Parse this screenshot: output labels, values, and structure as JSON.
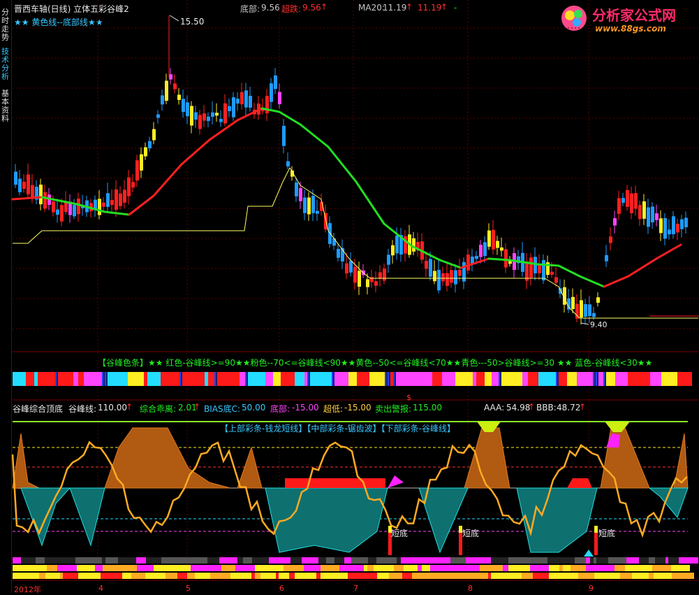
{
  "sidebar": {
    "tabs": [
      {
        "label": "分时走势",
        "color": "#c8c8c8"
      },
      {
        "label": "技术分析",
        "color": "#36c8ff"
      },
      {
        "label": "基本资料",
        "color": "#c8c8c8"
      }
    ]
  },
  "header": {
    "title": "晋西车轴(日线) 立体五彩谷峰2",
    "bottom_label": "底部:",
    "bottom_value": "9.56",
    "chaodie_label": "超跌:",
    "chaodie_value": "9.56",
    "ma20_label": "MA20:",
    "ma20_value": "11.19",
    "ma20_value2": "11.19",
    "ma20_dash": "-",
    "legend_line": "★★ 黄色线--底部线★★"
  },
  "logo": {
    "brand": "分析家公式网",
    "url": "www.88gs.com"
  },
  "annotations": {
    "high_price": "15.50",
    "low_price": "9.40",
    "s_marker": "$",
    "short_bottom": "短底"
  },
  "color_strip": {
    "legend": "【谷峰色条】★★ 红色-谷峰线>=90★★粉色--70<=谷峰线<90★★黄色--50<=谷峰线<70★★青色---50>谷峰线>=30 ★★ 蓝色-谷峰线<30★★"
  },
  "indicator": {
    "name": "谷峰综合顶底",
    "gufeng_label": "谷峰线:",
    "gufeng_value": "110.00",
    "zonghe_label": "综合乖离:",
    "zonghe_value": "2.01",
    "bias_label": "BIAS底C:",
    "bias_value": "50.00",
    "bottom_label": "底部:",
    "bottom_value": "-15.00",
    "chaodi_label": "超低:",
    "chaodi_value": "-15.00",
    "sell_label": "卖出警报:",
    "sell_value": "115.00",
    "aaa_label": "AAA:",
    "aaa_value": "54.98",
    "bbb_label": "BBB:",
    "bbb_value": "48.72",
    "inner_legend": "【上部彩条-钱龙短线】【中部彩条-锯齿波】【下部彩条-谷峰线】"
  },
  "date_axis": {
    "labels": [
      "2012年",
      "4",
      "5",
      "6",
      "7",
      "8",
      "9"
    ]
  },
  "chart_data": {
    "type": "candlestick",
    "title": "晋西车轴(日线) 立体五彩谷峰2",
    "annotated_high": 15.5,
    "annotated_low": 9.4,
    "bottom_line": 9.56,
    "ma20": 11.19,
    "indicator_values": {
      "谷峰线": 110.0,
      "综合乖离": 2.01,
      "BIAS底C": 50.0,
      "底部": -15.0,
      "超低": -15.0,
      "卖出警报": 115.0,
      "AAA": 54.98,
      "BBB": 48.72
    },
    "colors": {
      "up": "#ff2020",
      "down": "#1e9bff",
      "ma_up": "#ff2020",
      "ma_down": "#22dd22",
      "bottom_line": "#ffff66"
    }
  }
}
